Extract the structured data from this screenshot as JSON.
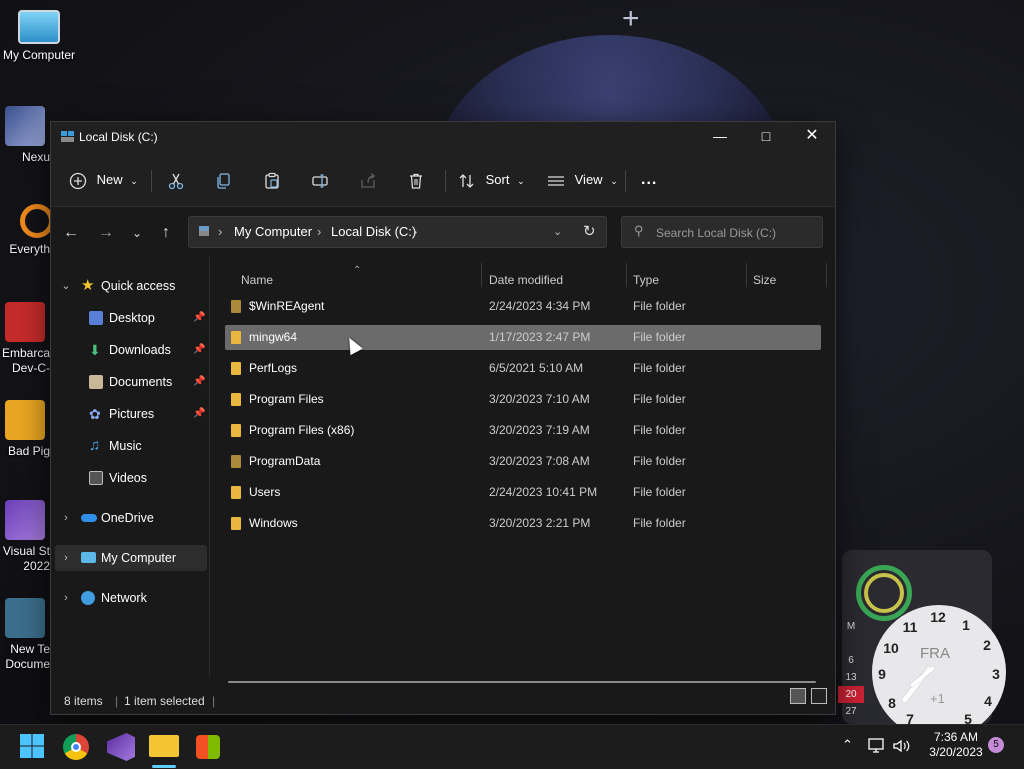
{
  "desktop": {
    "icons": [
      {
        "label": "My Computer"
      },
      {
        "label": "Nexu"
      },
      {
        "label": "Everyth"
      },
      {
        "label": "Embarca Dev-C-"
      },
      {
        "label": "Bad Pig"
      },
      {
        "label": "Visual St 2022"
      },
      {
        "label": "New Te Docume"
      }
    ],
    "widget": {
      "calendar_header": "M",
      "calendar_days": [
        "6",
        "13",
        "20",
        "27"
      ],
      "clock_timezone": "FRA",
      "clock_offset": "+1",
      "clock_numbers": [
        "12",
        "1",
        "2",
        "3",
        "4",
        "5",
        "7",
        "8",
        "9",
        "10",
        "11"
      ]
    }
  },
  "window": {
    "title": "Local Disk (C:)",
    "toolbar": {
      "new_label": "New",
      "sort_label": "Sort",
      "view_label": "View",
      "more_label": "..."
    },
    "address": {
      "segments": [
        "My Computer",
        "Local Disk (C:)"
      ]
    },
    "search": {
      "placeholder": "Search Local Disk (C:)"
    },
    "navpane": {
      "quick_access": "Quick access",
      "quick_items": [
        "Desktop",
        "Downloads",
        "Documents",
        "Pictures",
        "Music",
        "Videos"
      ],
      "onedrive": "OneDrive",
      "my_computer": "My Computer",
      "network": "Network"
    },
    "columns": {
      "name": "Name",
      "date": "Date modified",
      "type": "Type",
      "size": "Size"
    },
    "files": [
      {
        "name": "$WinREAgent",
        "date": "2/24/2023 4:34 PM",
        "type": "File folder"
      },
      {
        "name": "mingw64",
        "date": "1/17/2023 2:47 PM",
        "type": "File folder"
      },
      {
        "name": "PerfLogs",
        "date": "6/5/2021 5:10 AM",
        "type": "File folder"
      },
      {
        "name": "Program Files",
        "date": "3/20/2023 7:10 AM",
        "type": "File folder"
      },
      {
        "name": "Program Files (x86)",
        "date": "3/20/2023 7:19 AM",
        "type": "File folder"
      },
      {
        "name": "ProgramData",
        "date": "3/20/2023 7:08 AM",
        "type": "File folder"
      },
      {
        "name": "Users",
        "date": "2/24/2023 10:41 PM",
        "type": "File folder"
      },
      {
        "name": "Windows",
        "date": "3/20/2023 2:21 PM",
        "type": "File folder"
      }
    ],
    "status": {
      "item_count": "8 items",
      "selected": "1 item selected"
    }
  },
  "taskbar": {
    "time": "7:36 AM",
    "date": "3/20/2023",
    "notification_count": "5"
  },
  "colors": {
    "folder": "#e9b73f",
    "selection": "#6b6b6b",
    "window_bg": "#191919"
  }
}
